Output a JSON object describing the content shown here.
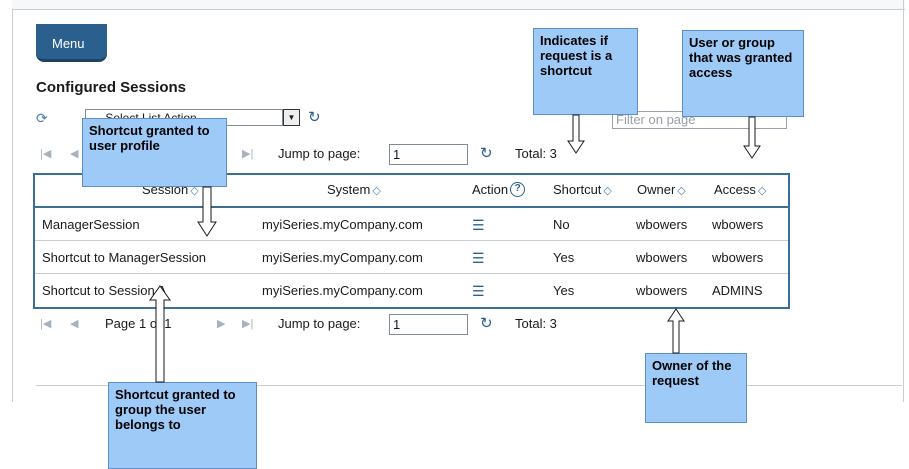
{
  "menu": {
    "label": "Menu"
  },
  "page": {
    "title": "Configured Sessions"
  },
  "actions": {
    "select_value": "--- Select List Action ---",
    "filter_placeholder": "Filter on page"
  },
  "pager_top": {
    "jump_label": "Jump to page:",
    "jump_value": "1",
    "total": "Total: 3"
  },
  "pager_bottom": {
    "page_info": "Page 1 of 1",
    "jump_label": "Jump to page:",
    "jump_value": "1",
    "total": "Total: 3"
  },
  "table": {
    "headers": [
      "Session",
      "System",
      "Action",
      "Shortcut",
      "Owner",
      "Access"
    ],
    "rows": [
      {
        "session": "ManagerSession",
        "system": "myiSeries.myCompany.com",
        "shortcut": "No",
        "owner": "wbowers",
        "access": "wbowers"
      },
      {
        "session": "Shortcut to ManagerSession",
        "system": "myiSeries.myCompany.com",
        "shortcut": "Yes",
        "owner": "wbowers",
        "access": "wbowers"
      },
      {
        "session": "Shortcut to Session A",
        "system": "myiSeries.myCompany.com",
        "shortcut": "Yes",
        "owner": "wbowers",
        "access": "ADMINS"
      }
    ]
  },
  "callouts": {
    "user_profile": "Shortcut granted to user profile",
    "shortcut_indicator": "Indicates if request is a shortcut",
    "access": "User or group that was granted access",
    "owner": "Owner of the request",
    "group": "Shortcut granted to group the user belongs to"
  },
  "colors": {
    "accent": "#2a5f8e",
    "callout": "#9ecaf7",
    "table_border": "#3c6f96"
  }
}
